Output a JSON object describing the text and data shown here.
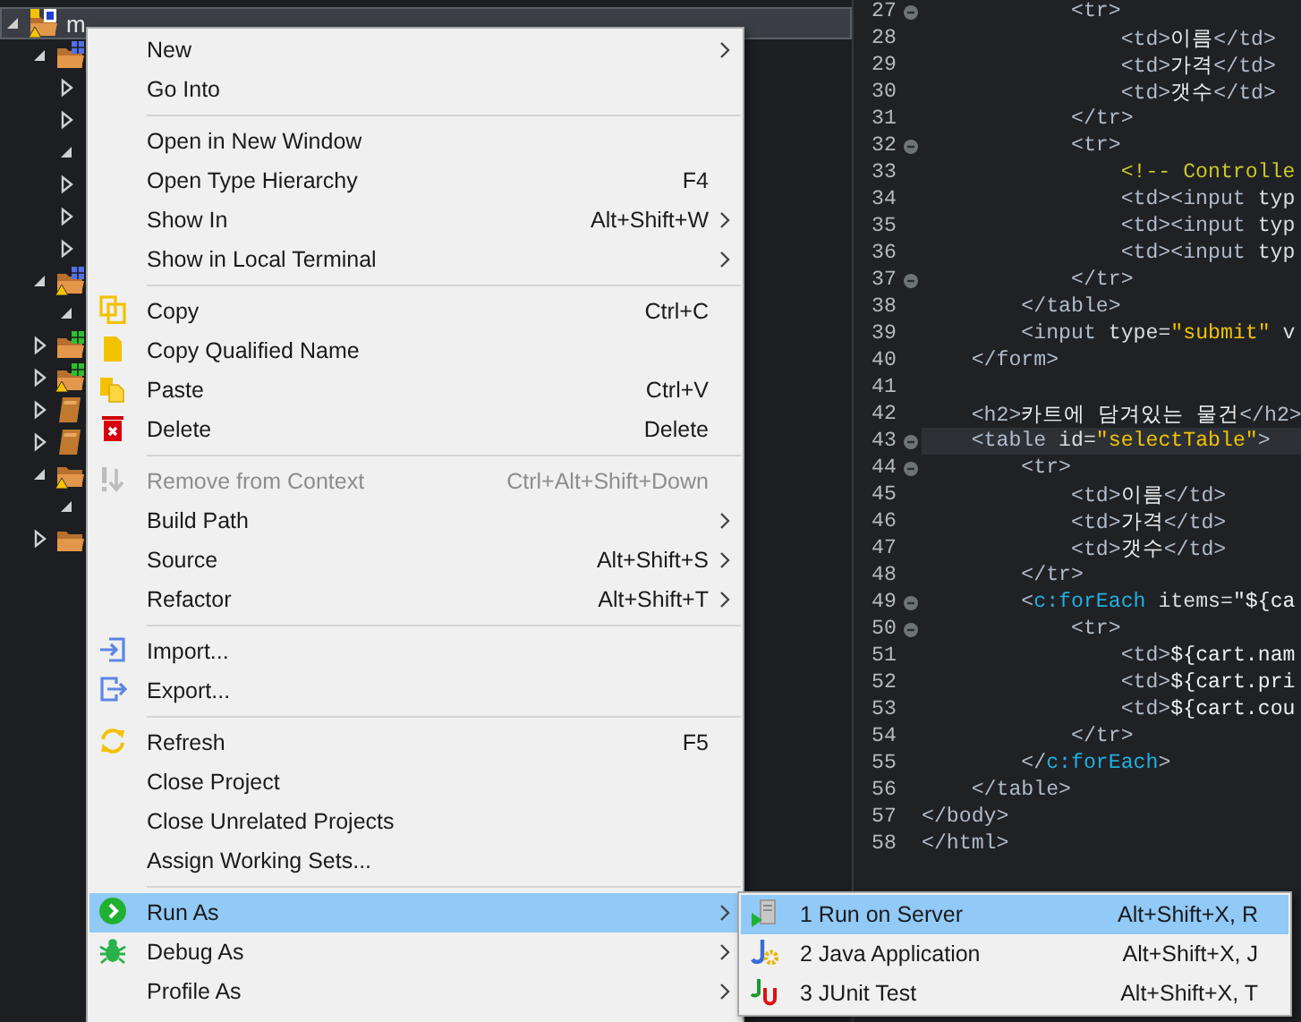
{
  "project_tree": {
    "items": [
      {
        "label": "m",
        "kind": "project",
        "warning": true,
        "expanded": true,
        "selected": true,
        "children": [
          {
            "kind": "package-folder",
            "warning": false,
            "expanded": true,
            "selected": false,
            "children": [
              {
                "expanded": false,
                "selected": false
              },
              {
                "expanded": false,
                "selected": false
              },
              {
                "expanded": true,
                "selected": false
              },
              {
                "expanded": false,
                "selected": false
              },
              {
                "expanded": false,
                "selected": false
              },
              {
                "expanded": false,
                "selected": false
              }
            ]
          },
          {
            "kind": "package-folder",
            "warning": true,
            "expanded": true,
            "selected": false,
            "children": [
              {
                "expanded": true,
                "selected": false
              }
            ]
          },
          {
            "kind": "green-folder",
            "warning": false,
            "expanded": false,
            "selected": false
          },
          {
            "kind": "green-folder",
            "warning": true,
            "expanded": false,
            "selected": false
          },
          {
            "kind": "book",
            "warning": false,
            "expanded": false,
            "selected": false
          },
          {
            "kind": "book",
            "warning": false,
            "expanded": false,
            "selected": false
          },
          {
            "kind": "folder",
            "warning": true,
            "expanded": true,
            "selected": false,
            "children": [
              {
                "expanded": true,
                "selected": false
              }
            ]
          },
          {
            "kind": "folder",
            "warning": false,
            "expanded": false,
            "selected": false
          }
        ]
      }
    ]
  },
  "editor": {
    "lines": [
      {
        "number": "27",
        "fold": true,
        "current": false,
        "tokens": [
          {
            "kind": "tag",
            "text": "            <tr>"
          }
        ]
      },
      {
        "number": "28",
        "fold": false,
        "current": false,
        "tokens": [
          {
            "kind": "tag",
            "text": "                <td>"
          },
          {
            "kind": "text",
            "text": "이름"
          },
          {
            "kind": "tag",
            "text": "</td>"
          }
        ]
      },
      {
        "number": "29",
        "fold": false,
        "current": false,
        "tokens": [
          {
            "kind": "tag",
            "text": "                <td>"
          },
          {
            "kind": "text",
            "text": "가격"
          },
          {
            "kind": "tag",
            "text": "</td>"
          }
        ]
      },
      {
        "number": "30",
        "fold": false,
        "current": false,
        "tokens": [
          {
            "kind": "tag",
            "text": "                <td>"
          },
          {
            "kind": "text",
            "text": "갯수"
          },
          {
            "kind": "tag",
            "text": "</td>"
          }
        ]
      },
      {
        "number": "31",
        "fold": false,
        "current": false,
        "tokens": [
          {
            "kind": "tag",
            "text": "            </tr>"
          }
        ]
      },
      {
        "number": "32",
        "fold": true,
        "current": false,
        "tokens": [
          {
            "kind": "tag",
            "text": "            <tr>"
          }
        ]
      },
      {
        "number": "33",
        "fold": false,
        "current": false,
        "tokens": [
          {
            "kind": "comment",
            "text": "                <!-- Controlle"
          }
        ]
      },
      {
        "number": "34",
        "fold": false,
        "current": false,
        "tokens": [
          {
            "kind": "tag",
            "text": "                <td><input"
          },
          {
            "kind": "attr",
            "text": " typ"
          }
        ]
      },
      {
        "number": "35",
        "fold": false,
        "current": false,
        "tokens": [
          {
            "kind": "tag",
            "text": "                <td><input"
          },
          {
            "kind": "attr",
            "text": " typ"
          }
        ]
      },
      {
        "number": "36",
        "fold": false,
        "current": false,
        "tokens": [
          {
            "kind": "tag",
            "text": "                <td><input"
          },
          {
            "kind": "attr",
            "text": " typ"
          }
        ]
      },
      {
        "number": "37",
        "fold": true,
        "current": false,
        "tokens": [
          {
            "kind": "tag",
            "text": "            </tr>"
          }
        ]
      },
      {
        "number": "38",
        "fold": false,
        "current": false,
        "tokens": [
          {
            "kind": "tag",
            "text": "        </table>"
          }
        ]
      },
      {
        "number": "39",
        "fold": false,
        "current": false,
        "tokens": [
          {
            "kind": "tag",
            "text": "        <input"
          },
          {
            "kind": "attr",
            "text": " type="
          },
          {
            "kind": "string",
            "text": "\"submit\""
          },
          {
            "kind": "attr",
            "text": " v"
          }
        ]
      },
      {
        "number": "40",
        "fold": false,
        "current": false,
        "tokens": [
          {
            "kind": "tag",
            "text": "    </form>"
          }
        ]
      },
      {
        "number": "41",
        "fold": false,
        "current": false
      },
      {
        "number": "42",
        "fold": false,
        "current": false,
        "tokens": [
          {
            "kind": "tag",
            "text": "    <h2>"
          },
          {
            "kind": "text",
            "text": "카트에 담겨있는 물건"
          },
          {
            "kind": "tag",
            "text": "</h2>"
          }
        ]
      },
      {
        "number": "43",
        "fold": true,
        "current": true,
        "tokens": [
          {
            "kind": "tag",
            "text": "    <table"
          },
          {
            "kind": "attr",
            "text": " id="
          },
          {
            "kind": "string",
            "text": "\"selectTable\""
          },
          {
            "kind": "tag",
            "text": ">"
          }
        ]
      },
      {
        "number": "44",
        "fold": true,
        "current": false,
        "tokens": [
          {
            "kind": "tag",
            "text": "        <tr>"
          }
        ]
      },
      {
        "number": "45",
        "fold": false,
        "current": false,
        "tokens": [
          {
            "kind": "tag",
            "text": "            <td>"
          },
          {
            "kind": "text",
            "text": "이름"
          },
          {
            "kind": "tag",
            "text": "</td>"
          }
        ]
      },
      {
        "number": "46",
        "fold": false,
        "current": false,
        "tokens": [
          {
            "kind": "tag",
            "text": "            <td>"
          },
          {
            "kind": "text",
            "text": "가격"
          },
          {
            "kind": "tag",
            "text": "</td>"
          }
        ]
      },
      {
        "number": "47",
        "fold": false,
        "current": false,
        "tokens": [
          {
            "kind": "tag",
            "text": "            <td>"
          },
          {
            "kind": "text",
            "text": "갯수"
          },
          {
            "kind": "tag",
            "text": "</td>"
          }
        ]
      },
      {
        "number": "48",
        "fold": false,
        "current": false,
        "tokens": [
          {
            "kind": "tag",
            "text": "        </tr>"
          }
        ]
      },
      {
        "number": "49",
        "fold": true,
        "current": false,
        "tokens": [
          {
            "kind": "tag",
            "text": "        <"
          },
          {
            "kind": "jstl",
            "text": "c:forEach"
          },
          {
            "kind": "attr",
            "text": " items="
          },
          {
            "kind": "text",
            "text": "\"${ca"
          }
        ]
      },
      {
        "number": "50",
        "fold": true,
        "current": false,
        "tokens": [
          {
            "kind": "tag",
            "text": "            <tr>"
          }
        ]
      },
      {
        "number": "51",
        "fold": false,
        "current": false,
        "tokens": [
          {
            "kind": "tag",
            "text": "                <td>"
          },
          {
            "kind": "text",
            "text": "${cart.nam"
          }
        ]
      },
      {
        "number": "52",
        "fold": false,
        "current": false,
        "tokens": [
          {
            "kind": "tag",
            "text": "                <td>"
          },
          {
            "kind": "text",
            "text": "${cart.pri"
          }
        ]
      },
      {
        "number": "53",
        "fold": false,
        "current": false,
        "tokens": [
          {
            "kind": "tag",
            "text": "                <td>"
          },
          {
            "kind": "text",
            "text": "${cart.cou"
          }
        ]
      },
      {
        "number": "54",
        "fold": false,
        "current": false,
        "tokens": [
          {
            "kind": "tag",
            "text": "            </tr>"
          }
        ]
      },
      {
        "number": "55",
        "fold": false,
        "current": false,
        "tokens": [
          {
            "kind": "tag",
            "text": "        </"
          },
          {
            "kind": "jstl",
            "text": "c:forEach"
          },
          {
            "kind": "tag",
            "text": ">"
          }
        ]
      },
      {
        "number": "56",
        "fold": false,
        "current": false,
        "tokens": [
          {
            "kind": "tag",
            "text": "    </table>"
          }
        ]
      },
      {
        "number": "57",
        "fold": false,
        "current": false,
        "tokens": [
          {
            "kind": "tag",
            "text": "</body>"
          }
        ]
      },
      {
        "number": "58",
        "fold": false,
        "current": false,
        "tokens": [
          {
            "kind": "tag",
            "text": "</html>"
          }
        ]
      }
    ]
  },
  "context_menu": {
    "items": [
      {
        "kind": "item",
        "label": "New",
        "submenu": true,
        "disabled": false,
        "selected": false
      },
      {
        "kind": "item",
        "label": "Go Into",
        "submenu": false,
        "disabled": false,
        "selected": false
      },
      {
        "kind": "separator"
      },
      {
        "kind": "item",
        "label": "Open in New Window",
        "submenu": false,
        "disabled": false,
        "selected": false
      },
      {
        "kind": "item",
        "label": "Open Type Hierarchy",
        "shortcut": "F4",
        "submenu": false,
        "disabled": false,
        "selected": false
      },
      {
        "kind": "item",
        "label": "Show In",
        "shortcut": "Alt+Shift+W",
        "submenu": true,
        "disabled": false,
        "selected": false
      },
      {
        "kind": "item",
        "label": "Show in Local Terminal",
        "submenu": true,
        "disabled": false,
        "selected": false
      },
      {
        "kind": "separator"
      },
      {
        "kind": "copy",
        "label": "Copy",
        "shortcut": "Ctrl+C",
        "submenu": false,
        "disabled": false,
        "selected": false
      },
      {
        "kind": "page",
        "label": "Copy Qualified Name",
        "submenu": false,
        "disabled": false,
        "selected": false
      },
      {
        "kind": "paste",
        "label": "Paste",
        "shortcut": "Ctrl+V",
        "submenu": false,
        "disabled": false,
        "selected": false
      },
      {
        "kind": "delete",
        "label": "Delete",
        "shortcut": "Delete",
        "submenu": false,
        "disabled": false,
        "selected": false
      },
      {
        "kind": "separator"
      },
      {
        "kind": "remove",
        "label": "Remove from Context",
        "shortcut": "Ctrl+Alt+Shift+Down",
        "submenu": false,
        "disabled": true,
        "selected": false
      },
      {
        "kind": "item",
        "label": "Build Path",
        "submenu": true,
        "disabled": false,
        "selected": false
      },
      {
        "kind": "item",
        "label": "Source",
        "shortcut": "Alt+Shift+S",
        "submenu": true,
        "disabled": false,
        "selected": false
      },
      {
        "kind": "item",
        "label": "Refactor",
        "shortcut": "Alt+Shift+T",
        "submenu": true,
        "disabled": false,
        "selected": false
      },
      {
        "kind": "separator"
      },
      {
        "kind": "import",
        "label": "Import...",
        "submenu": false,
        "disabled": false,
        "selected": false
      },
      {
        "kind": "export",
        "label": "Export...",
        "submenu": false,
        "disabled": false,
        "selected": false
      },
      {
        "kind": "separator"
      },
      {
        "kind": "refresh",
        "label": "Refresh",
        "shortcut": "F5",
        "submenu": false,
        "disabled": false,
        "selected": false
      },
      {
        "kind": "item",
        "label": "Close Project",
        "submenu": false,
        "disabled": false,
        "selected": false
      },
      {
        "kind": "item",
        "label": "Close Unrelated Projects",
        "submenu": false,
        "disabled": false,
        "selected": false
      },
      {
        "kind": "item",
        "label": "Assign Working Sets...",
        "submenu": false,
        "disabled": false,
        "selected": false
      },
      {
        "kind": "separator"
      },
      {
        "kind": "run",
        "label": "Run As",
        "submenu": true,
        "disabled": false,
        "selected": true
      },
      {
        "kind": "debug",
        "label": "Debug As",
        "submenu": true,
        "disabled": false,
        "selected": false
      },
      {
        "kind": "item",
        "label": "Profile As",
        "submenu": true,
        "disabled": false,
        "selected": false
      }
    ]
  },
  "submenu": {
    "items": [
      {
        "kind": "server",
        "label": "1 Run on Server",
        "shortcut": "Alt+Shift+X, R",
        "selected": true
      },
      {
        "kind": "java",
        "label": "2 Java Application",
        "shortcut": "Alt+Shift+X, J",
        "selected": false
      },
      {
        "kind": "junit",
        "label": "3 JUnit Test",
        "shortcut": "Alt+Shift+X, T",
        "selected": false
      }
    ]
  }
}
